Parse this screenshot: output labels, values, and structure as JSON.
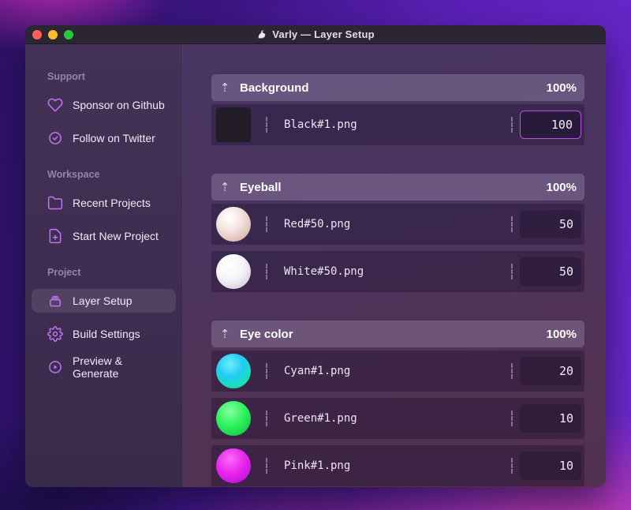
{
  "window": {
    "title": "Varly — Layer Setup",
    "app_icon": "unicorn-icon",
    "traffic_lights": [
      {
        "name": "close",
        "color": "#ff5f57"
      },
      {
        "name": "minimize",
        "color": "#febc2e"
      },
      {
        "name": "zoom",
        "color": "#28c840"
      }
    ]
  },
  "sidebar": {
    "sections": [
      {
        "label": "Support",
        "items": [
          {
            "icon": "heart-icon",
            "label": "Sponsor on Github",
            "selected": false
          },
          {
            "icon": "badge-check-icon",
            "label": "Follow on Twitter",
            "selected": false
          }
        ]
      },
      {
        "label": "Workspace",
        "items": [
          {
            "icon": "folder-icon",
            "label": "Recent Projects",
            "selected": false
          },
          {
            "icon": "file-plus-icon",
            "label": "Start New Project",
            "selected": false
          }
        ]
      },
      {
        "label": "Project",
        "items": [
          {
            "icon": "layers-box-icon",
            "label": "Layer Setup",
            "selected": true
          },
          {
            "icon": "gear-icon",
            "label": "Build Settings",
            "selected": false
          },
          {
            "icon": "play-circle-icon",
            "label": "Preview & Generate",
            "selected": false
          }
        ]
      }
    ]
  },
  "layers": {
    "groups": [
      {
        "name": "Background",
        "weight": "100%",
        "rows": [
          {
            "thumb": "black-swatch",
            "file": "Black#1.png",
            "value": "100",
            "focused": true
          }
        ]
      },
      {
        "name": "Eyeball",
        "weight": "100%",
        "rows": [
          {
            "thumb": "pearl-red",
            "file": "Red#50.png",
            "value": "50",
            "focused": false
          },
          {
            "thumb": "pearl-white",
            "file": "White#50.png",
            "value": "50",
            "focused": false
          }
        ]
      },
      {
        "name": "Eye color",
        "weight": "100%",
        "rows": [
          {
            "thumb": "sphere-cyan",
            "file": "Cyan#1.png",
            "value": "20",
            "focused": false
          },
          {
            "thumb": "sphere-green",
            "file": "Green#1.png",
            "value": "10",
            "focused": false
          },
          {
            "thumb": "sphere-pink",
            "file": "Pink#1.png",
            "value": "10",
            "focused": false
          }
        ]
      }
    ]
  },
  "colors": {
    "accent_icon": "#c173f2",
    "focus_border": "#bd50e8",
    "titlebar_bg": "#2b2632",
    "selected_item_bg": "rgba(255,255,255,0.10)"
  }
}
